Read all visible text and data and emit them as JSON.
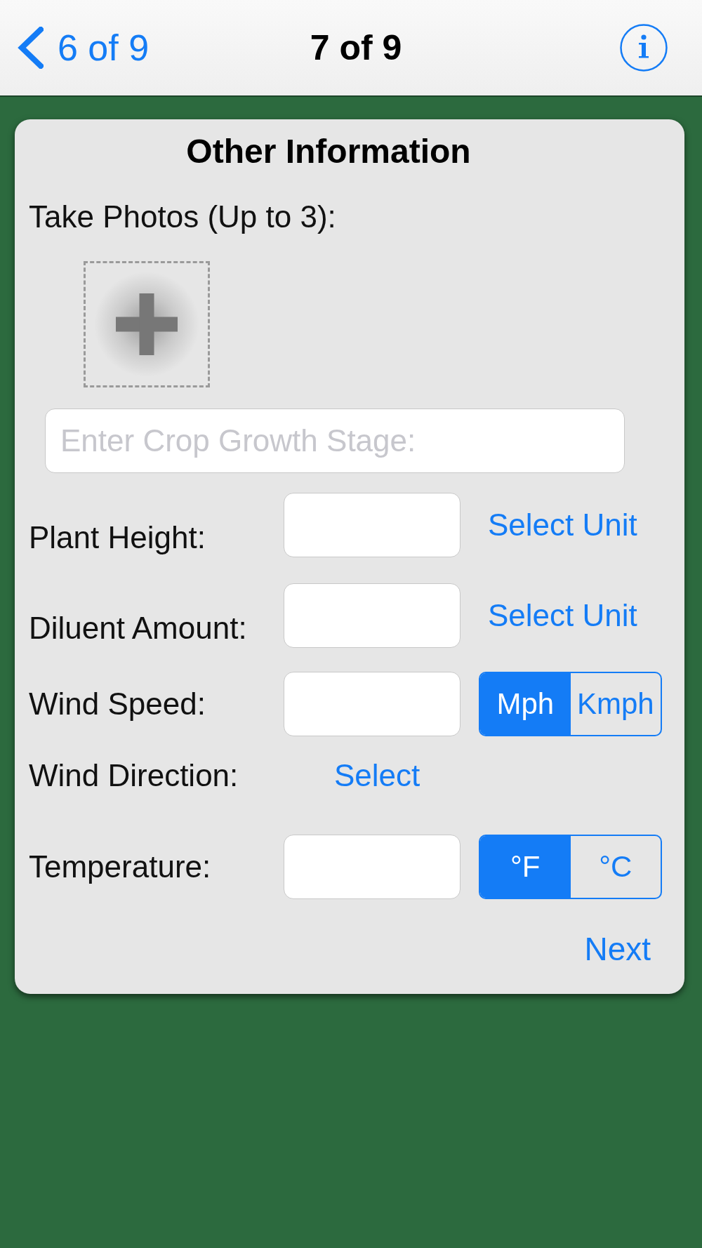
{
  "nav_bar": {
    "back_button": {
      "label": "6 of 9"
    },
    "title": "7 of 9"
  },
  "card": {
    "title": "Other Information",
    "photos": {
      "label": "Take Photos (Up to 3):"
    },
    "growth_stage_field": {
      "placeholder": "Enter Crop Growth Stage:"
    },
    "rows": [
      {
        "kind": "unit_picker",
        "label": "Plant Height:",
        "action": "Select Unit"
      },
      {
        "kind": "unit_picker",
        "label": "Diluent Amount:",
        "action": "Select Unit"
      },
      {
        "kind": "segmented",
        "label": "Wind Speed:",
        "segments": [
          {
            "label": "Mph",
            "selected": true
          },
          {
            "label": "Kmph",
            "selected": false
          }
        ]
      },
      {
        "kind": "picker",
        "label": "Wind Direction:",
        "action": "Select"
      },
      {
        "kind": "segmented",
        "label": "Temperature:",
        "segments": [
          {
            "label": "°F",
            "selected": true
          },
          {
            "label": "°C",
            "selected": false
          }
        ]
      }
    ],
    "next_button": "Next"
  }
}
